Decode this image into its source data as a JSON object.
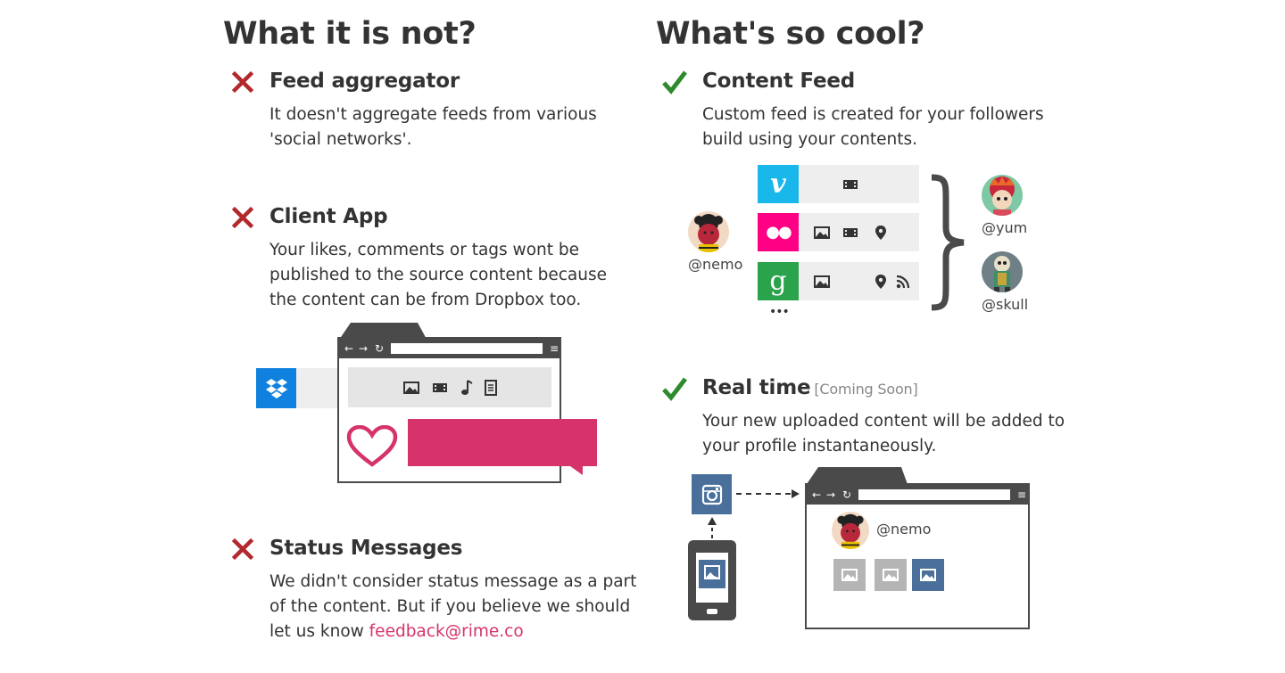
{
  "left_section": {
    "title": "What it is not?",
    "items": [
      {
        "icon": "cross-icon",
        "title": "Feed aggregator",
        "desc_lines": [
          "It doesn't aggregate feeds from various",
          "'social networks'."
        ]
      },
      {
        "icon": "cross-icon",
        "title": "Client App",
        "desc_lines": [
          "Your likes, comments or tags wont be",
          "published to the source content because",
          "the content can be from Dropbox too."
        ]
      },
      {
        "icon": "cross-icon",
        "title": "Status Messages",
        "desc_lines": [
          "We didn't consider status message as a part",
          "of the content. But if you believe we should"
        ],
        "desc_last_prefix": "let us know ",
        "link": "feedback@rime.co"
      }
    ]
  },
  "right_section": {
    "title": "What's so cool?",
    "items": [
      {
        "icon": "check-icon",
        "title": "Content Feed",
        "desc_lines": [
          "Custom feed is created for your followers",
          "build using your contents."
        ]
      },
      {
        "icon": "check-icon",
        "title": "Real time",
        "badge": "[Coming Soon]",
        "desc_lines": [
          "Your new uploaded content will be added to",
          "your profile instantaneously."
        ]
      }
    ]
  },
  "feed_diagram": {
    "source_user": "@nemo",
    "followers": [
      "@yum",
      "@skull"
    ],
    "services": [
      {
        "name": "vimeo",
        "glyph": "v",
        "color": "#1ab7ea"
      },
      {
        "name": "flickr",
        "glyph": "●●",
        "color": "#ff0084"
      },
      {
        "name": "google",
        "glyph": "g",
        "color": "#2ba24c"
      }
    ],
    "more": "•••"
  },
  "realtime_diagram": {
    "profile_user": "@nemo"
  },
  "colors": {
    "cross": "#b3282d",
    "check": "#2d8a2d",
    "dropbox": "#1081de",
    "instagram": "#4a6f9a",
    "pink": "#d6336c",
    "dark": "#4a4a4a"
  }
}
